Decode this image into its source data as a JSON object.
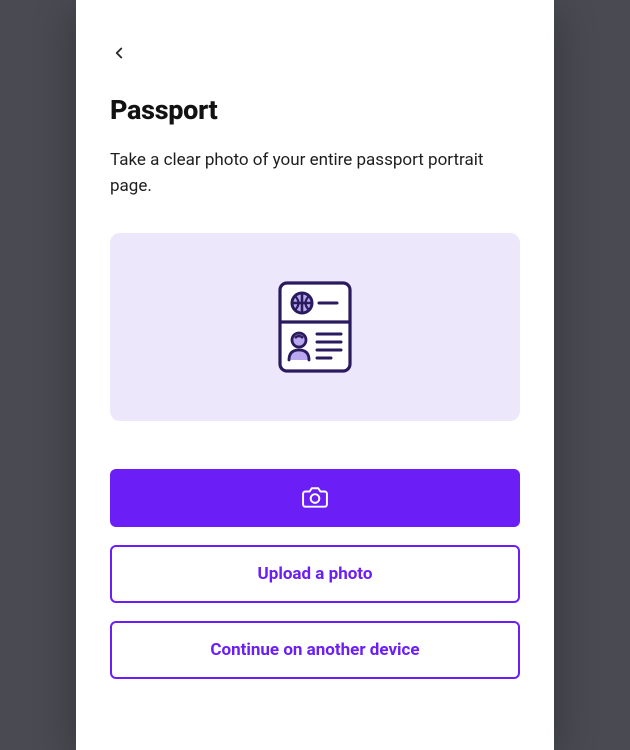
{
  "header": {
    "title": "Passport",
    "subtitle": "Take a clear photo of your entire passport portrait page."
  },
  "buttons": {
    "upload_label": "Upload a photo",
    "continue_label": "Continue on another device"
  },
  "colors": {
    "accent": "#6b1ef5",
    "panel_bg": "#ece7fa"
  },
  "icons": {
    "back": "chevron-left",
    "passport": "passport-document",
    "camera": "camera"
  }
}
